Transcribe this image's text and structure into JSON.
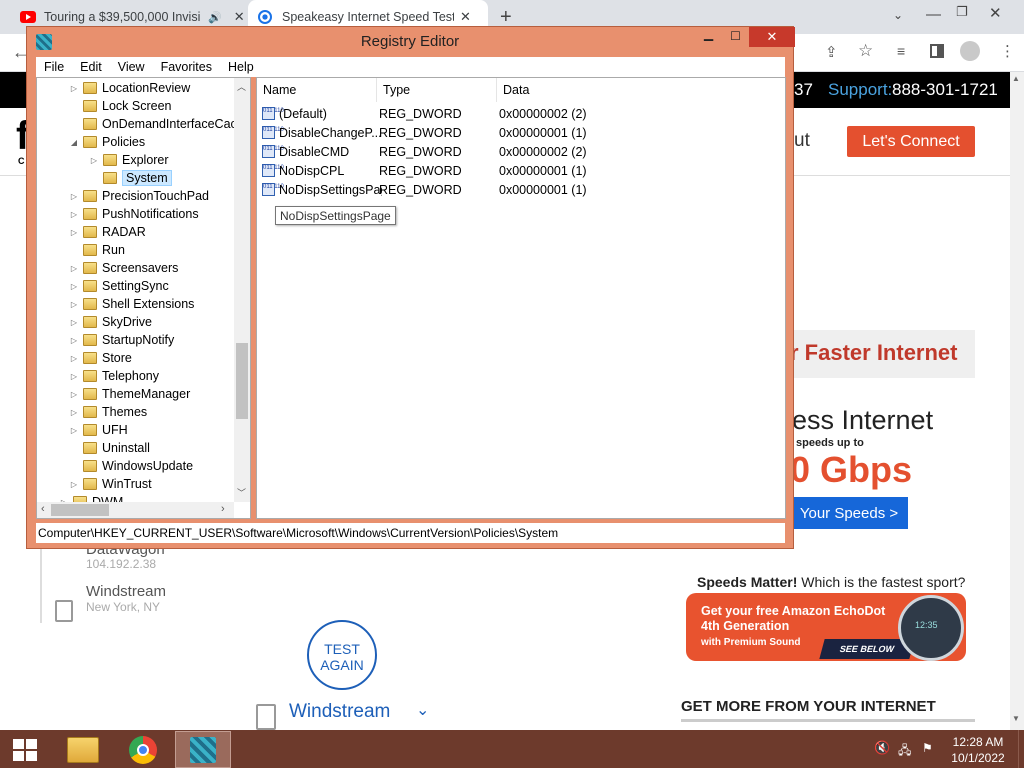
{
  "browser": {
    "tabs": [
      {
        "title": "Touring a $39,500,000 Invisi",
        "icon": "youtube-icon",
        "active": false
      },
      {
        "title": "Speakeasy Internet Speed Test -",
        "icon": "speakeasy-icon",
        "active": true
      }
    ],
    "new_tab": "+",
    "win_controls": [
      "chevron-down-icon",
      "minimize-icon",
      "restore-icon",
      "close-icon"
    ]
  },
  "website": {
    "phone_fragment": "37",
    "support_label": "Support:",
    "support_phone": "888-301-1721",
    "nav_fragment": "ut",
    "connect_button": "Let's Connect",
    "promo_faster": "r Faster Internet",
    "promo_wireless": "ess Internet",
    "promo_speeds_up": "speeds up to",
    "promo_gbps": "0 Gbps",
    "promo_your_speeds": "Your Speeds >",
    "results": [
      {
        "name": "DataWagon",
        "ip": "104.192.2.38"
      },
      {
        "name": "Windstream",
        "location": "New York, NY"
      }
    ],
    "test_again": "TEST AGAIN",
    "selected_server": "Windstream",
    "speeds_matter": "Speeds Matter!",
    "fastest_sport": " Which is the fastest sport?",
    "ad_title": "Get your free Amazon EchoDot",
    "ad_gen": "4th Generation",
    "ad_sub": "with Premium Sound",
    "ad_see": "SEE BELOW",
    "ad_clock": "12:35",
    "get_more": "GET MORE FROM YOUR INTERNET",
    "sidebar_logo_fragment": "f",
    "sidebar_logo_fragment2": "C"
  },
  "regedit": {
    "title": "Registry Editor",
    "menu": [
      "File",
      "Edit",
      "View",
      "Favorites",
      "Help"
    ],
    "tree": [
      {
        "label": "LocationReview",
        "level": 1,
        "expand": "collapsed"
      },
      {
        "label": "Lock Screen",
        "level": 1,
        "expand": "none"
      },
      {
        "label": "OnDemandInterfaceCach",
        "level": 1,
        "expand": "none"
      },
      {
        "label": "Policies",
        "level": 1,
        "expand": "expanded"
      },
      {
        "label": "Explorer",
        "level": 2,
        "expand": "collapsed"
      },
      {
        "label": "System",
        "level": 2,
        "expand": "none",
        "selected": true
      },
      {
        "label": "PrecisionTouchPad",
        "level": 1,
        "expand": "collapsed"
      },
      {
        "label": "PushNotifications",
        "level": 1,
        "expand": "collapsed"
      },
      {
        "label": "RADAR",
        "level": 1,
        "expand": "collapsed"
      },
      {
        "label": "Run",
        "level": 1,
        "expand": "none"
      },
      {
        "label": "Screensavers",
        "level": 1,
        "expand": "collapsed"
      },
      {
        "label": "SettingSync",
        "level": 1,
        "expand": "collapsed"
      },
      {
        "label": "Shell Extensions",
        "level": 1,
        "expand": "collapsed"
      },
      {
        "label": "SkyDrive",
        "level": 1,
        "expand": "collapsed"
      },
      {
        "label": "StartupNotify",
        "level": 1,
        "expand": "collapsed"
      },
      {
        "label": "Store",
        "level": 1,
        "expand": "collapsed"
      },
      {
        "label": "Telephony",
        "level": 1,
        "expand": "collapsed"
      },
      {
        "label": "ThemeManager",
        "level": 1,
        "expand": "collapsed"
      },
      {
        "label": "Themes",
        "level": 1,
        "expand": "collapsed"
      },
      {
        "label": "UFH",
        "level": 1,
        "expand": "collapsed"
      },
      {
        "label": "Uninstall",
        "level": 1,
        "expand": "none"
      },
      {
        "label": "WindowsUpdate",
        "level": 1,
        "expand": "none"
      },
      {
        "label": "WinTrust",
        "level": 1,
        "expand": "collapsed"
      },
      {
        "label": "DWM",
        "level": 0,
        "expand": "collapsed"
      }
    ],
    "columns": [
      "Name",
      "Type",
      "Data"
    ],
    "values": [
      {
        "name": "(Default)",
        "type": "REG_DWORD",
        "data": "0x00000002 (2)"
      },
      {
        "name": "DisableChangeP...",
        "type": "REG_DWORD",
        "data": "0x00000001 (1)"
      },
      {
        "name": "DisableCMD",
        "type": "REG_DWORD",
        "data": "0x00000002 (2)"
      },
      {
        "name": "NoDispCPL",
        "type": "REG_DWORD",
        "data": "0x00000001 (1)"
      },
      {
        "name": "NoDispSettingsPage",
        "type": "REG_DWORD",
        "data": "0x00000001 (1)"
      }
    ],
    "tooltip": "NoDispSettingsPage",
    "status_path": "Computer\\HKEY_CURRENT_USER\\Software\\Microsoft\\Windows\\CurrentVersion\\Policies\\System",
    "icon_text": "011 110"
  },
  "taskbar": {
    "time": "12:28 AM",
    "date": "10/1/2022",
    "apps": [
      "file-explorer-icon",
      "chrome-icon",
      "registry-editor-icon"
    ]
  },
  "colors": {
    "window_frame": "#e8906e",
    "taskbar": "#6d3a2c",
    "accent_red": "#e4502f",
    "support_blue": "#4aa3e0"
  }
}
